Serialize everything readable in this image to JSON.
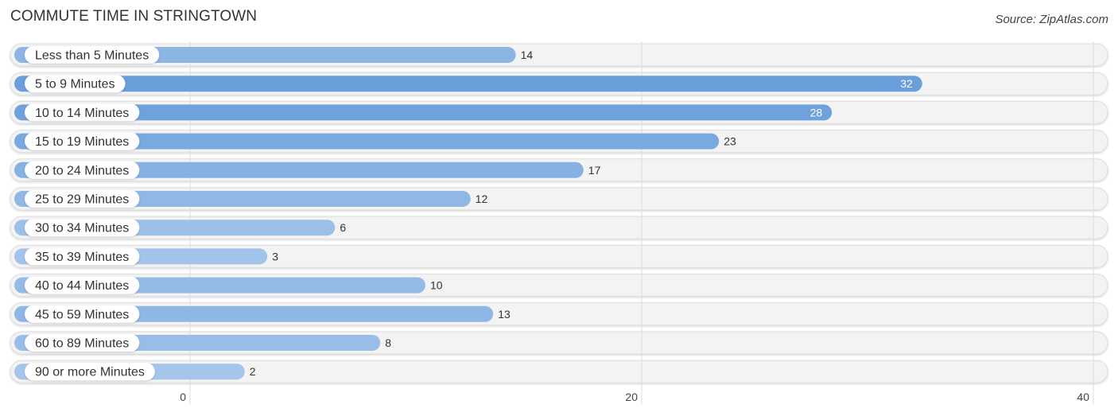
{
  "header": {
    "title": "COMMUTE TIME IN STRINGTOWN",
    "source": "Source: ZipAtlas.com"
  },
  "colors": {
    "bar_strong": "#6a9fdb",
    "bar_light": "#a9c8ec",
    "track": "#f3f3f3",
    "grid": "#dddddd"
  },
  "chart_data": {
    "type": "bar",
    "orientation": "horizontal",
    "title": "COMMUTE TIME IN STRINGTOWN",
    "xlabel": "",
    "ylabel": "",
    "categories": [
      "Less than 5 Minutes",
      "5 to 9 Minutes",
      "10 to 14 Minutes",
      "15 to 19 Minutes",
      "20 to 24 Minutes",
      "25 to 29 Minutes",
      "30 to 34 Minutes",
      "35 to 39 Minutes",
      "40 to 44 Minutes",
      "45 to 59 Minutes",
      "60 to 89 Minutes",
      "90 or more Minutes"
    ],
    "values": [
      14,
      32,
      28,
      23,
      17,
      12,
      6,
      3,
      10,
      13,
      8,
      2
    ],
    "xlim": [
      0,
      40
    ],
    "xticks": [
      0,
      20,
      40
    ],
    "grid": true,
    "legend": "none"
  }
}
